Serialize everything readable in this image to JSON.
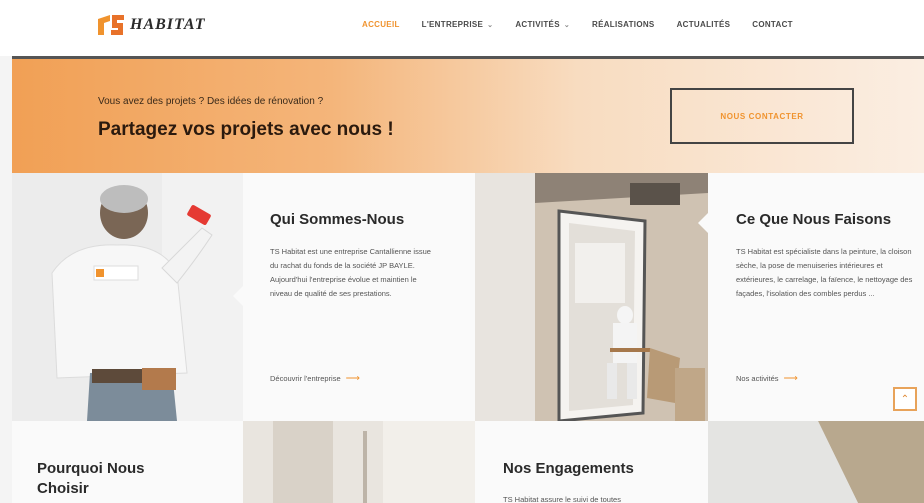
{
  "header": {
    "logo_text": "HABITAT",
    "nav": [
      {
        "label": "ACCUEIL",
        "active": true,
        "has_dropdown": false
      },
      {
        "label": "L'ENTREPRISE",
        "active": false,
        "has_dropdown": true
      },
      {
        "label": "ACTIVITÉS",
        "active": false,
        "has_dropdown": true
      },
      {
        "label": "RÉALISATIONS",
        "active": false,
        "has_dropdown": false
      },
      {
        "label": "ACTUALITÉS",
        "active": false,
        "has_dropdown": false
      },
      {
        "label": "CONTACT",
        "active": false,
        "has_dropdown": false
      }
    ]
  },
  "banner": {
    "subtitle": "Vous avez des projets ? Des idées de rénovation ?",
    "title": "Partagez vos projets avec nous !",
    "button_label": "NOUS CONTACTER"
  },
  "cards": {
    "qui": {
      "title": "Qui Sommes-Nous",
      "body": "TS Habitat est une entreprise Cantallienne issue du rachat du fonds de la société JP BAYLE. Aujourd'hui l'entreprise évolue et maintien le niveau de qualité de ses prestations.",
      "link": "Découvrir l'entreprise"
    },
    "faisons": {
      "title": "Ce Que Nous Faisons",
      "body": "TS Habitat est spécialiste dans la peinture, la cloison sèche, la pose de menuiseries intérieures et extérieures, le carrelage, la faïence, le nettoyage des façades, l'isolation des combles perdus ...",
      "link": "Nos activités"
    },
    "pourquoi": {
      "title": "Pourquoi Nous Choisir"
    },
    "engagements": {
      "title": "Nos Engagements",
      "body": "TS Habitat assure le suivi de toutes"
    }
  },
  "scroll_top": {
    "icon": "chevron-up-icon",
    "glyph": "⌃"
  },
  "colors": {
    "accent": "#f0932e",
    "banner_start": "#f1a055",
    "banner_end": "#fbeee2"
  }
}
